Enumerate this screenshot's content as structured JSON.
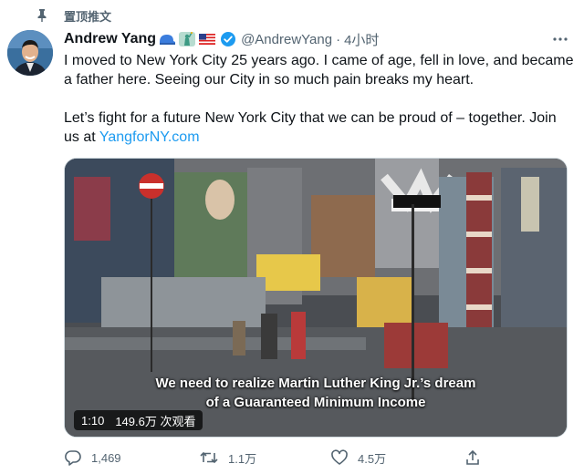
{
  "pinned": {
    "label": "置顶推文"
  },
  "author": {
    "name": "Andrew Yang",
    "handle": "@AndrewYang",
    "separator": "·",
    "time": "4小时"
  },
  "tweet": {
    "paragraph1": "I moved to New York City 25 years ago. I came of age, fell in love, and became a father here. Seeing our City in so much pain breaks my heart.",
    "paragraph2_prefix": "Let’s fight for a future New York City that we can be proud of – together. Join us at ",
    "link_text": "YangforNY.com"
  },
  "video": {
    "caption_line1": "We need to realize Martin Luther King Jr.’s dream",
    "caption_line2": "of a Guaranteed Minimum Income",
    "duration": "1:10",
    "views": "149.6万 次观看"
  },
  "actions": {
    "reply_count": "1,469",
    "retweet_count": "1.1万",
    "like_count": "4.5万"
  },
  "icons": {
    "pin": "pin-icon",
    "verified": "verified-badge-icon",
    "more": "more-icon",
    "reply": "reply-icon",
    "retweet": "retweet-icon",
    "like": "heart-icon",
    "share": "share-icon"
  },
  "colors": {
    "link": "#1d9bf0",
    "secondary_text": "#536471",
    "verified": "#1d9bf0"
  }
}
